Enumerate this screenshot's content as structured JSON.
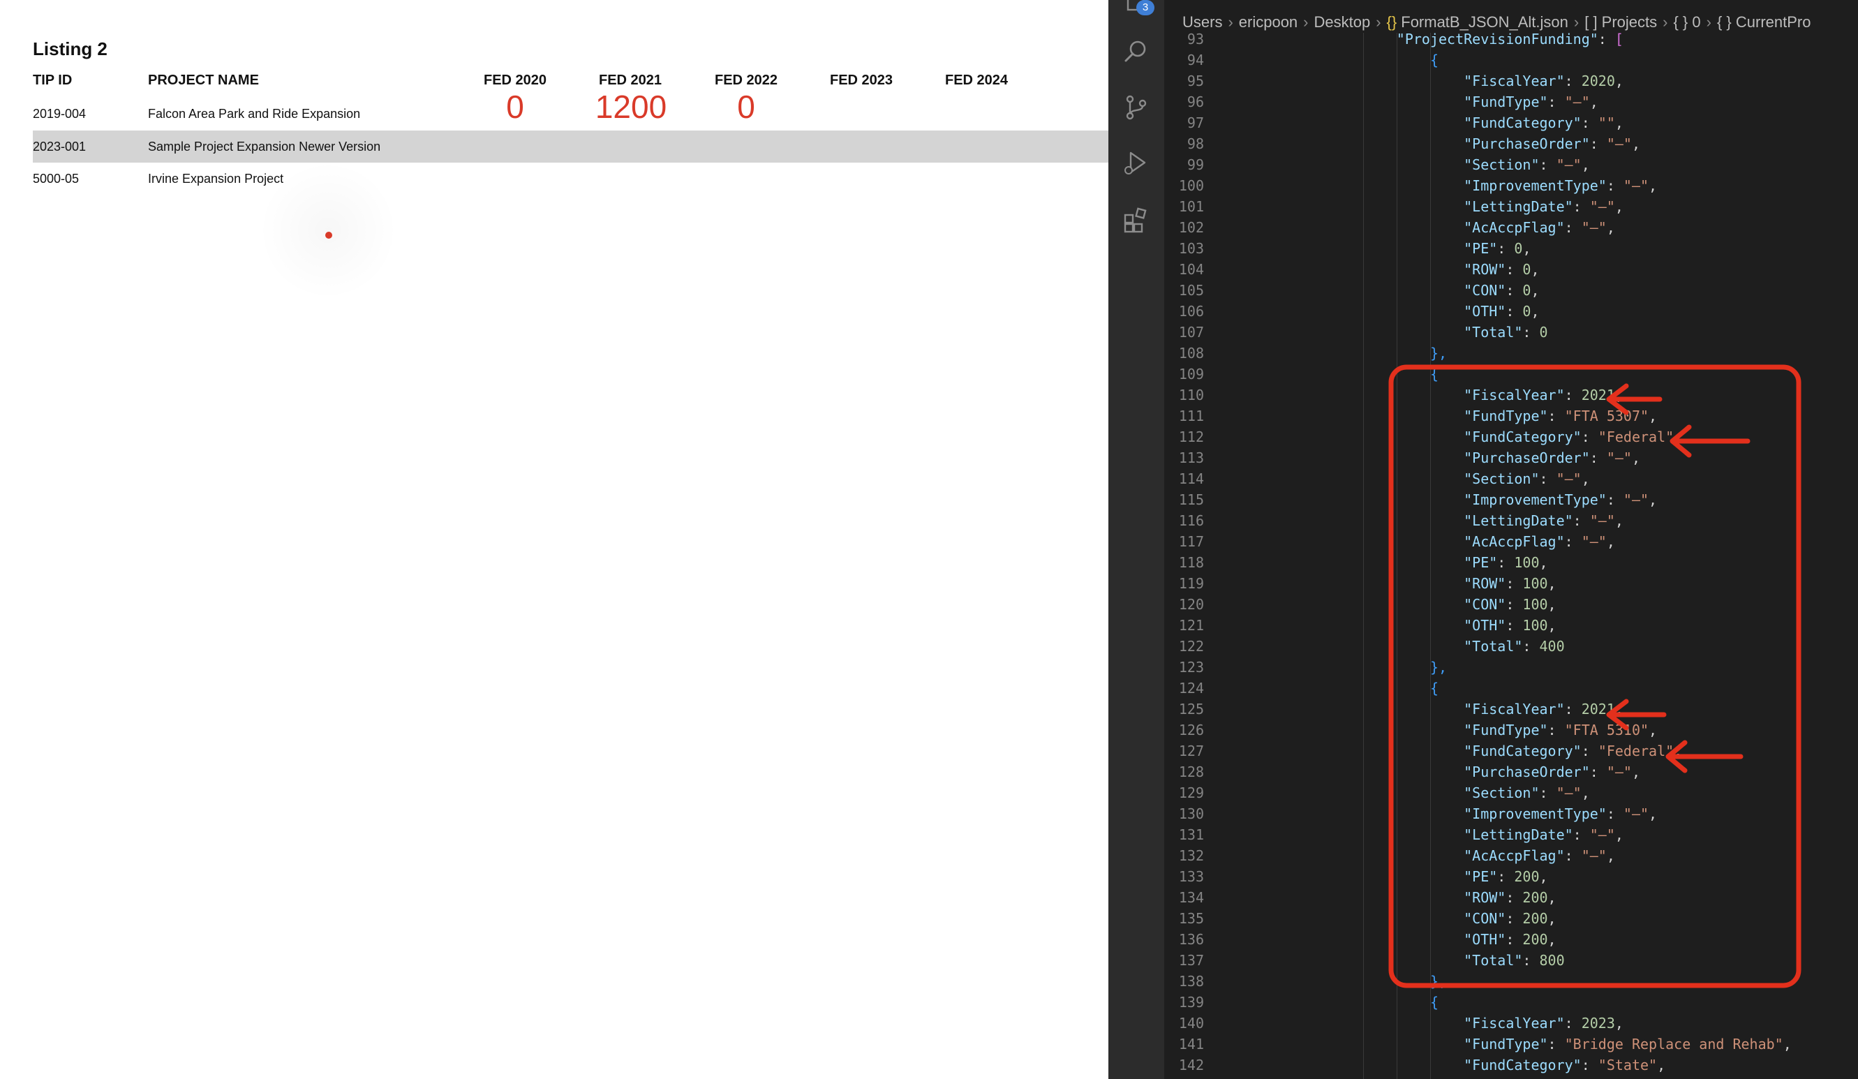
{
  "listing": {
    "title": "Listing 2",
    "headers": {
      "tip_id": "TIP ID",
      "project_name": "PROJECT NAME",
      "fed2020": "FED 2020",
      "fed2021": "FED 2021",
      "fed2022": "FED 2022",
      "fed2023": "FED 2023",
      "fed2024": "FED 2024"
    },
    "rows": [
      {
        "tip_id": "2019-004",
        "name": "Falcon Area Park and Ride Expansion",
        "fed2020": "0",
        "fed2021": "1200",
        "fed2022": "0"
      },
      {
        "tip_id": "2023-001",
        "name": "Sample Project Expansion Newer Version"
      },
      {
        "tip_id": "5000-05",
        "name": "Irvine Expansion Project"
      }
    ]
  },
  "editor": {
    "badge_count": "3",
    "breadcrumb": {
      "items": [
        "Users",
        "ericpoon",
        "Desktop"
      ],
      "file_icon": "{}",
      "file": "FormatB_JSON_Alt.json",
      "path": [
        "[ ] Projects",
        "{ } 0",
        "{ } CurrentPro"
      ]
    },
    "lines": [
      {
        "n": "93",
        "indent": 5,
        "key": "ProjectRevisionFunding",
        "kind": "open-array"
      },
      {
        "n": "94",
        "indent": 6,
        "text": "{",
        "kind": "brace"
      },
      {
        "n": "95",
        "indent": 7,
        "key": "FiscalYear",
        "num": "2020",
        "comma": true
      },
      {
        "n": "96",
        "indent": 7,
        "key": "FundType",
        "str": "\"–\"",
        "comma": true
      },
      {
        "n": "97",
        "indent": 7,
        "key": "FundCategory",
        "str": "\"\"",
        "comma": true
      },
      {
        "n": "98",
        "indent": 7,
        "key": "PurchaseOrder",
        "str": "\"–\"",
        "comma": true
      },
      {
        "n": "99",
        "indent": 7,
        "key": "Section",
        "str": "\"–\"",
        "comma": true
      },
      {
        "n": "100",
        "indent": 7,
        "key": "ImprovementType",
        "str": "\"–\"",
        "comma": true
      },
      {
        "n": "101",
        "indent": 7,
        "key": "LettingDate",
        "str": "\"–\"",
        "comma": true
      },
      {
        "n": "102",
        "indent": 7,
        "key": "AcAccpFlag",
        "str": "\"–\"",
        "comma": true
      },
      {
        "n": "103",
        "indent": 7,
        "key": "PE",
        "num": "0",
        "comma": true
      },
      {
        "n": "104",
        "indent": 7,
        "key": "ROW",
        "num": "0",
        "comma": true
      },
      {
        "n": "105",
        "indent": 7,
        "key": "CON",
        "num": "0",
        "comma": true
      },
      {
        "n": "106",
        "indent": 7,
        "key": "OTH",
        "num": "0",
        "comma": true
      },
      {
        "n": "107",
        "indent": 7,
        "key": "Total",
        "num": "0"
      },
      {
        "n": "108",
        "indent": 6,
        "text": "},",
        "kind": "brace"
      },
      {
        "n": "109",
        "indent": 6,
        "text": "{",
        "kind": "brace"
      },
      {
        "n": "110",
        "indent": 7,
        "key": "FiscalYear",
        "num": "2021",
        "comma": true
      },
      {
        "n": "111",
        "indent": 7,
        "key": "FundType",
        "str": "\"FTA 5307\"",
        "comma": true
      },
      {
        "n": "112",
        "indent": 7,
        "key": "FundCategory",
        "str": "\"Federal\"",
        "comma": true
      },
      {
        "n": "113",
        "indent": 7,
        "key": "PurchaseOrder",
        "str": "\"–\"",
        "comma": true
      },
      {
        "n": "114",
        "indent": 7,
        "key": "Section",
        "str": "\"–\"",
        "comma": true
      },
      {
        "n": "115",
        "indent": 7,
        "key": "ImprovementType",
        "str": "\"–\"",
        "comma": true
      },
      {
        "n": "116",
        "indent": 7,
        "key": "LettingDate",
        "str": "\"–\"",
        "comma": true
      },
      {
        "n": "117",
        "indent": 7,
        "key": "AcAccpFlag",
        "str": "\"–\"",
        "comma": true
      },
      {
        "n": "118",
        "indent": 7,
        "key": "PE",
        "num": "100",
        "comma": true
      },
      {
        "n": "119",
        "indent": 7,
        "key": "ROW",
        "num": "100",
        "comma": true
      },
      {
        "n": "120",
        "indent": 7,
        "key": "CON",
        "num": "100",
        "comma": true
      },
      {
        "n": "121",
        "indent": 7,
        "key": "OTH",
        "num": "100",
        "comma": true
      },
      {
        "n": "122",
        "indent": 7,
        "key": "Total",
        "num": "400"
      },
      {
        "n": "123",
        "indent": 6,
        "text": "},",
        "kind": "brace"
      },
      {
        "n": "124",
        "indent": 6,
        "text": "{",
        "kind": "brace"
      },
      {
        "n": "125",
        "indent": 7,
        "key": "FiscalYear",
        "num": "2021",
        "comma": true
      },
      {
        "n": "126",
        "indent": 7,
        "key": "FundType",
        "str": "\"FTA 5310\"",
        "comma": true
      },
      {
        "n": "127",
        "indent": 7,
        "key": "FundCategory",
        "str": "\"Federal\"",
        "comma": true
      },
      {
        "n": "128",
        "indent": 7,
        "key": "PurchaseOrder",
        "str": "\"–\"",
        "comma": true
      },
      {
        "n": "129",
        "indent": 7,
        "key": "Section",
        "str": "\"–\"",
        "comma": true
      },
      {
        "n": "130",
        "indent": 7,
        "key": "ImprovementType",
        "str": "\"–\"",
        "comma": true
      },
      {
        "n": "131",
        "indent": 7,
        "key": "LettingDate",
        "str": "\"–\"",
        "comma": true
      },
      {
        "n": "132",
        "indent": 7,
        "key": "AcAccpFlag",
        "str": "\"–\"",
        "comma": true
      },
      {
        "n": "133",
        "indent": 7,
        "key": "PE",
        "num": "200",
        "comma": true
      },
      {
        "n": "134",
        "indent": 7,
        "key": "ROW",
        "num": "200",
        "comma": true
      },
      {
        "n": "135",
        "indent": 7,
        "key": "CON",
        "num": "200",
        "comma": true
      },
      {
        "n": "136",
        "indent": 7,
        "key": "OTH",
        "num": "200",
        "comma": true
      },
      {
        "n": "137",
        "indent": 7,
        "key": "Total",
        "num": "800"
      },
      {
        "n": "138",
        "indent": 6,
        "text": "},",
        "kind": "brace"
      },
      {
        "n": "139",
        "indent": 6,
        "text": "{",
        "kind": "brace"
      },
      {
        "n": "140",
        "indent": 7,
        "key": "FiscalYear",
        "num": "2023",
        "comma": true
      },
      {
        "n": "141",
        "indent": 7,
        "key": "FundType",
        "str": "\"Bridge Replace and Rehab\"",
        "comma": true
      },
      {
        "n": "142",
        "indent": 7,
        "key": "FundCategory",
        "str": "\"State\"",
        "comma": true
      }
    ]
  },
  "icons": {
    "explorer": "files-icon",
    "search": "search-icon",
    "scm": "source-control-icon",
    "debug": "run-debug-icon",
    "extensions": "extensions-icon"
  },
  "colors": {
    "highlight": "#d93a29",
    "editor_bg": "#1e1e1e",
    "row_shade": "#d4d4d4"
  }
}
